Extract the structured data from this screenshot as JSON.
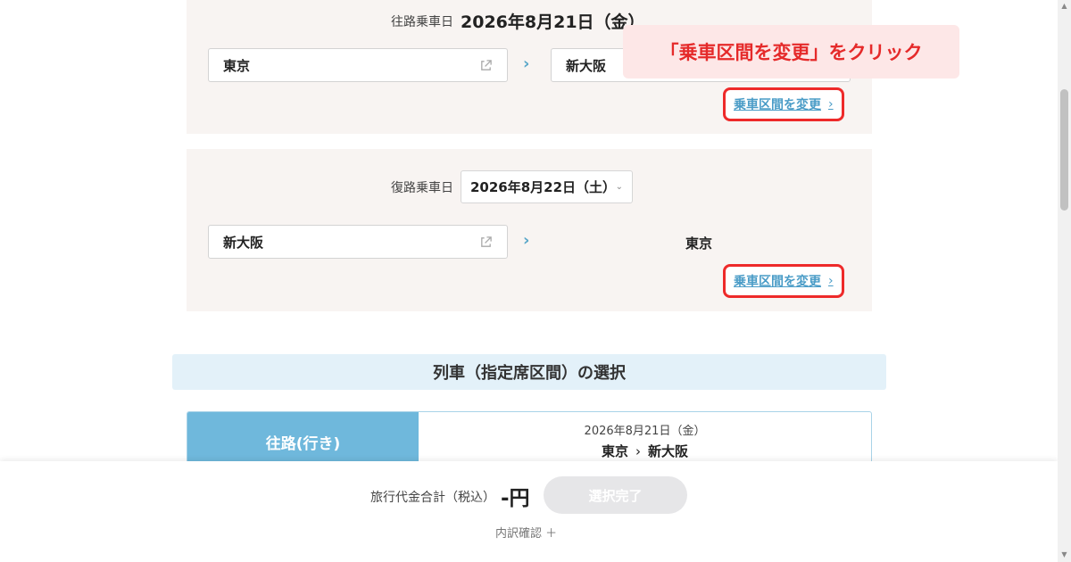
{
  "outbound": {
    "date_label": "往路乗車日",
    "date_value": "2026年8月21日（金）",
    "from": "東京",
    "to": "新大阪",
    "change_label": "乗車区間を変更"
  },
  "callout_text": "「乗車区間を変更」をクリック",
  "return": {
    "date_label": "復路乗車日",
    "date_value": "2026年8月22日（土）",
    "from": "新大阪",
    "to": "東京",
    "change_label": "乗車区間を変更"
  },
  "section_title": "列車（指定席区間）の選択",
  "train_card": {
    "tab_label": "往路(行き)",
    "date": "2026年8月21日（金）",
    "from": "東京",
    "separator": "›",
    "to": "新大阪"
  },
  "footer": {
    "total_label": "旅行代金合計（税込）",
    "total_value": "-円",
    "complete_label": "選択完了",
    "breakdown_label": "内訳確認 ＋"
  },
  "colors": {
    "accent_blue": "#4a9cc7",
    "highlight_red": "#ee2a2a",
    "tab_blue": "#6fb8dc"
  }
}
